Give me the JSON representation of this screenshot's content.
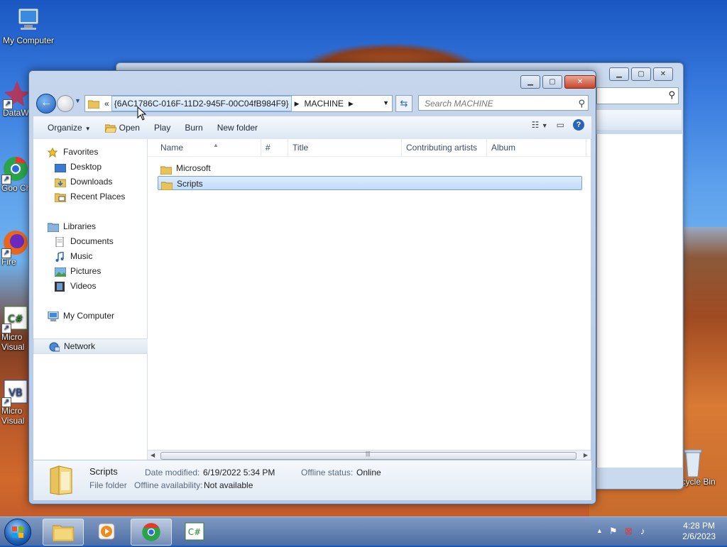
{
  "desktop": {
    "icons": [
      {
        "label": "My Computer"
      },
      {
        "label": "DataWa"
      },
      {
        "label": "Goo Chro"
      },
      {
        "label": "Fire"
      },
      {
        "label": "Micro Visual"
      },
      {
        "label": "Micro Visual"
      },
      {
        "label": "Recycle Bin"
      }
    ]
  },
  "window": {
    "address": {
      "overflow": "«",
      "crumbs": [
        "{6AC1786C-016F-11D2-945F-00C04fB984F9}",
        "MACHINE"
      ]
    },
    "search": {
      "placeholder": "Search MACHINE"
    },
    "toolbar": {
      "organize": "Organize",
      "open": "Open",
      "play": "Play",
      "burn": "Burn",
      "new_folder": "New folder"
    },
    "nav": {
      "favorites": "Favorites",
      "desktop": "Desktop",
      "downloads": "Downloads",
      "recent": "Recent Places",
      "libraries": "Libraries",
      "documents": "Documents",
      "music": "Music",
      "pictures": "Pictures",
      "videos": "Videos",
      "computer": "My Computer",
      "network": "Network"
    },
    "columns": {
      "name": "Name",
      "number": "#",
      "title": "Title",
      "artists": "Contributing artists",
      "album": "Album"
    },
    "files": [
      {
        "name": "Microsoft",
        "selected": false
      },
      {
        "name": "Scripts",
        "selected": true
      }
    ],
    "details": {
      "name": "Scripts",
      "type": "File folder",
      "date_label": "Date modified:",
      "date_value": "6/19/2022 5:34 PM",
      "offline_status_label": "Offline status:",
      "offline_status_value": "Online",
      "offline_avail_label": "Offline availability:",
      "offline_avail_value": "Not available"
    }
  },
  "taskbar": {
    "time": "4:28 PM",
    "date": "2/6/2023"
  },
  "colors": {
    "accent": "#2a64b8",
    "selection": "#c1dcf9"
  }
}
